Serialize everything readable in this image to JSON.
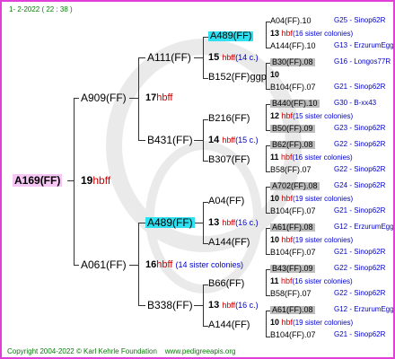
{
  "header": {
    "date": "1-   2-2022 ( 22 : 38 )"
  },
  "footer": {
    "copyright": "Copyright 2004-2022 © Karl Kehrle Foundation",
    "website": "www.pedigreeapis.org"
  },
  "root": {
    "code": "A169(FF)",
    "num": "19",
    "label": "hbff"
  },
  "gen2": [
    {
      "code": "A909(FF)",
      "num": "17",
      "label": "hbff"
    },
    {
      "code": "A061(FF)",
      "num": "16",
      "label": "hbff",
      "note": "(14 sister colonies)"
    }
  ],
  "gen3": [
    {
      "code": "A111(FF)",
      "num": "15",
      "label": "hbff",
      "note": "(14 c.)"
    },
    {
      "code": "B431(FF)",
      "num": "14",
      "label": "hbff",
      "note": "(15 c.)"
    },
    {
      "code": "A489(FF)",
      "num": "13",
      "label": "hbff",
      "note": "(16 c.)"
    },
    {
      "code": "B338(FF)",
      "num": "13",
      "label": "hbff",
      "note": "(16 c.)"
    }
  ],
  "gen4": [
    {
      "code": "A489(FF)"
    },
    {
      "code": "B152(FF)ggp"
    },
    {
      "code": "B216(FF)"
    },
    {
      "code": "B307(FF)"
    },
    {
      "code": "A04(FF)"
    },
    {
      "code": "A144(FF)"
    },
    {
      "code": "B66(FF)"
    },
    {
      "code": "A144(FF)"
    }
  ],
  "gen5": [
    {
      "top": "A04(FF).10",
      "topinfo": "G25 - Sinop62R",
      "num": "13",
      "label": "hbf",
      "note": "(16 sister colonies)",
      "bot": "A144(FF).10",
      "botinfo": "G13 - ErzurumEgg8"
    },
    {
      "top": "B30(FF).08",
      "topinfo": "G16 - Longos77R",
      "num": "10",
      "label": "",
      "note": "",
      "bot": "B104(FF).07",
      "botinfo": "G21 - Sinop62R"
    },
    {
      "top": "B440(FF).10",
      "topinfo": "G30 - B-xx43",
      "num": "12",
      "label": "hbf",
      "note": "(15 sister colonies)",
      "bot": "B50(FF).09",
      "botinfo": "G23 - Sinop62R"
    },
    {
      "top": "B62(FF).08",
      "topinfo": "G22 - Sinop62R",
      "num": "11",
      "label": "hbf",
      "note": "(16 sister colonies)",
      "bot": "B58(FF).07",
      "botinfo": "G22 - Sinop62R"
    },
    {
      "top": "A702(FF).08",
      "topinfo": "G24 - Sinop62R",
      "num": "10",
      "label": "hbf",
      "note": "(19 sister colonies)",
      "bot": "B104(FF).07",
      "botinfo": "G21 - Sinop62R"
    },
    {
      "top": "A61(FF).08",
      "topinfo": "G12 - ErzurumEgg8",
      "num": "10",
      "label": "hbf",
      "note": "(19 sister colonies)",
      "bot": "B104(FF).07",
      "botinfo": "G21 - Sinop62R"
    },
    {
      "top": "B43(FF).09",
      "topinfo": "G22 - Sinop62R",
      "num": "11",
      "label": "hbf",
      "note": "(16 sister colonies)",
      "bot": "B58(FF).07",
      "botinfo": "G22 - Sinop62R"
    },
    {
      "top": "A61(FF).08",
      "topinfo": "G12 - ErzurumEgg8",
      "num": "10",
      "label": "hbf",
      "note": "(19 sister colonies)",
      "bot": "B104(FF).07",
      "botinfo": "G21 - Sinop62R"
    }
  ]
}
